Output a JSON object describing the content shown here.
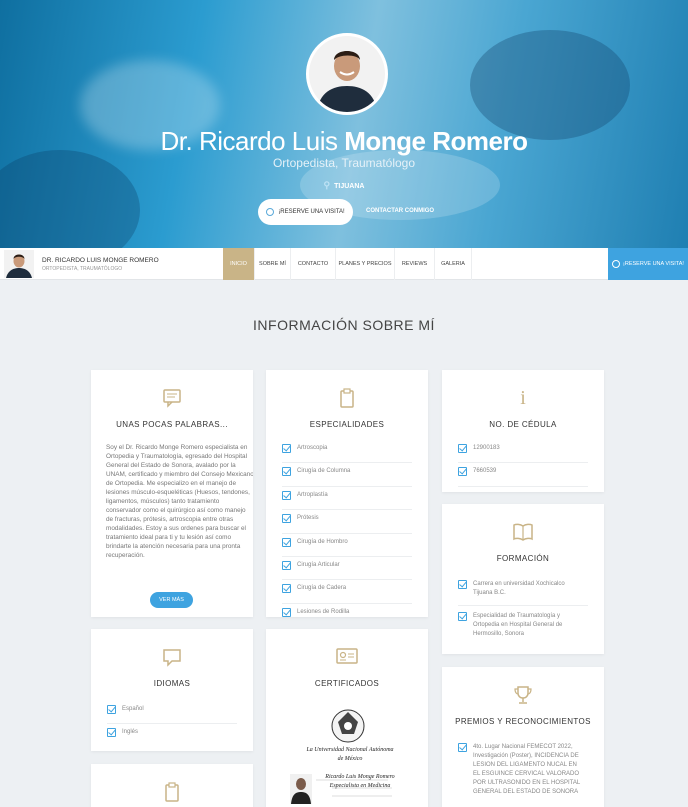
{
  "hero": {
    "name_first": "Dr. Ricardo Luis",
    "name_last": "Monge Romero",
    "specialty": "Ortopedista, Traumatólogo",
    "location": "TIJUANA",
    "reserve_button": "¡RESERVE UNA VISITA!",
    "contact_link": "CONTACTAR CONMIGO"
  },
  "nav": {
    "doctor_name": "DR. RICARDO LUIS MONGE ROMERO",
    "doctor_specialty": "ORTOPEDISTA, TRAUMATÓLOGO",
    "items": [
      "INICIO",
      "SOBRE MÍ",
      "CONTACTO",
      "PLANES Y PRECIOS",
      "REVIEWS",
      "GALERIA"
    ],
    "cta": "¡RESERVE UNA VISITA!"
  },
  "section_title": "INFORMACIÓN SOBRE MÍ",
  "cards": {
    "about": {
      "title": "UNAS POCAS PALABRAS...",
      "text": "Soy el Dr. Ricardo Monge Romero especialista en Ortopedia y Traumatología, egresado del Hospital General del Estado de Sonora, avalado por la UNAM, certificado y miembro del Consejo Mexicano de Ortopedia. Me especializo en el manejo de lesiones músculo-esqueléticas (Huesos, tendones, ligamentos, músculos) tanto tratamiento conservador como el quirúrgico así como manejo de fracturas, prótesis, artroscopia entre otras modalidades. Estoy a sus ordenes para buscar el tratamiento ideal para ti y tu lesión así como brindarte la atención necesaria para una pronta recuperación.",
      "more_button": "VER MÁS"
    },
    "specialties": {
      "title": "ESPECIALIDADES",
      "items": [
        "Artroscopia",
        "Cirugía de Columna",
        "Artroplastía",
        "Prótesis",
        "Cirugía de Hombro",
        "Cirugía Articular",
        "Cirugía de Cadera",
        "Lesiones de Rodilla"
      ]
    },
    "license": {
      "title": "NO. DE CÉDULA",
      "items": [
        "12900183",
        "7660539"
      ]
    },
    "education": {
      "title": "FORMACIÓN",
      "items": [
        "Carrera en universidad Xochicalco Tijuana B.C.",
        "Especialidad de Traumatología y Ortopedia en Hospital General de Hermosillo, Sonora"
      ]
    },
    "languages": {
      "title": "IDIOMAS",
      "items": [
        "Español",
        "Inglés"
      ]
    },
    "certificates": {
      "title": "CERTIFICADOS",
      "cert_lines": [
        "La Universidad Nacional Autónoma",
        "de México",
        "Ricardo Luis Monge Romero",
        "Especialista en Medicina"
      ]
    },
    "awards": {
      "title": "PREMIOS Y RECONOCIMIENTOS",
      "items": [
        "4to. Lugar Nacional FEMECOT 2022, Investigación (Poster), INCIDENCIA DE LESION DEL LIGAMENTO NUCAL EN EL ESGUINCE CERVICAL VALORADO POR ULTRASONIDO EN EL HOSPITAL GENERAL DEL ESTADO DE SONORA"
      ]
    }
  }
}
